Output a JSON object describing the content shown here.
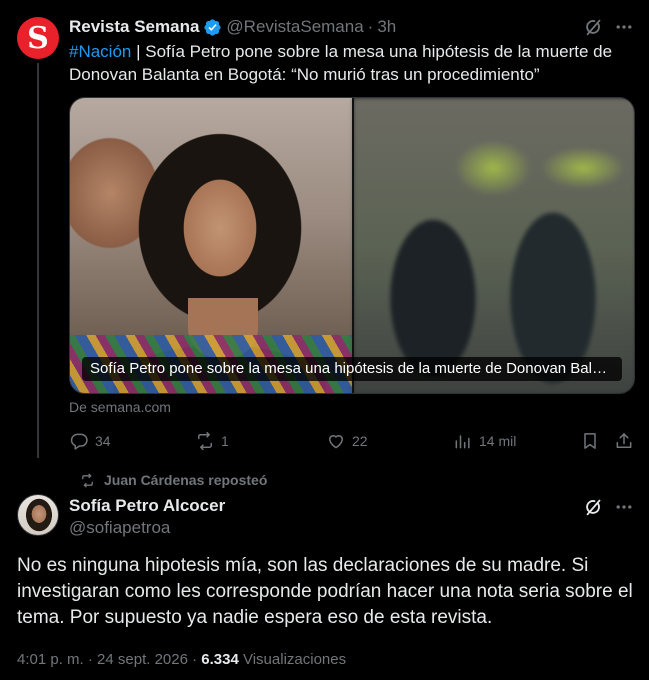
{
  "quoted_tweet": {
    "avatar_letter": "S",
    "name": "Revista Semana",
    "handle": "@RevistaSemana",
    "separator": "·",
    "time": "3h",
    "hashtag": "#Nación",
    "text": " | Sofía Petro pone sobre la mesa una hipótesis de la muerte de Donovan Balanta en Bogotá: “No murió tras un procedimiento”",
    "card": {
      "caption": "Sofía Petro pone sobre la mesa una hipótesis de la muerte de Donovan Balant...",
      "source": "De semana.com"
    },
    "actions": {
      "replies": "34",
      "reposts": "1",
      "likes": "22",
      "views": "14 mil"
    }
  },
  "repost": {
    "text": "Juan Cárdenas reposteó"
  },
  "main_tweet": {
    "name": "Sofía Petro Alcocer",
    "handle": "@sofiapetroa",
    "text": "No es ninguna hipotesis mía, son las declaraciones de su madre. Si investigaran como les corresponde podrían hacer una nota seria sobre el tema. Por supuesto ya nadie espera eso de esta revista.",
    "timestamp": "4:01 p. m. · 24 sept. 2026 · ",
    "views_count": "6.334",
    "views_label": " Visualizaciones"
  },
  "colors": {
    "background": "#000000",
    "text": "#e7e9ea",
    "muted": "#71767b",
    "link": "#1d9bf0",
    "verified": "#1d9bf0",
    "semana_brand": "#e8212b"
  },
  "icons": [
    "verified-badge-icon",
    "grok-icon",
    "more-icon",
    "reply-icon",
    "repost-icon",
    "like-icon",
    "views-icon",
    "bookmark-icon",
    "share-icon"
  ]
}
